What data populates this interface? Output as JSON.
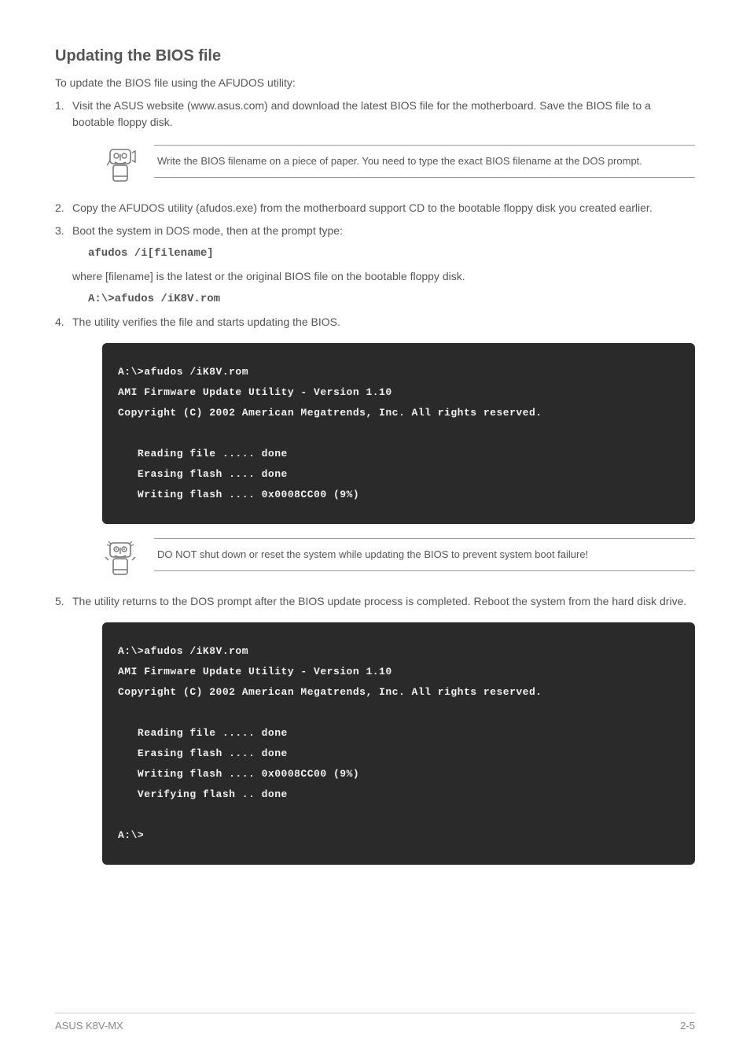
{
  "header": {
    "title": "Updating the BIOS file"
  },
  "intro": "To update the BIOS file using the AFUDOS utility:",
  "steps": {
    "s1_num": "1.",
    "s1_text_a": "Visit the ASUS website (www.asus.com) and download the latest BIOS file for the motherboard. Save the BIOS file to a bootable floppy disk.",
    "s2_num": "2.",
    "s2_text": "Copy the AFUDOS utility (afudos.exe) from the motherboard support CD to the bootable floppy disk you created earlier.",
    "s3_num": "3.",
    "s3_text": "Boot the system in DOS mode, then at the prompt type:",
    "s3_cmd": "afudos /i[filename]",
    "s3_after": "where [filename] is the latest or the original BIOS file on the bootable floppy disk.",
    "s3_example": "A:\\>afudos /iK8V.rom",
    "s4_num": "4.",
    "s4_text": "The utility verifies the file and starts updating the BIOS.",
    "s5_num": "5.",
    "s5_text": "The utility returns to the DOS prompt after the BIOS update process is completed. Reboot the system from the hard disk drive."
  },
  "notes": {
    "note1": "Write the BIOS filename on a piece of paper. You need to type the exact BIOS filename at the DOS prompt.",
    "note2": "DO NOT shut down or reset the system while updating the BIOS to prevent system boot failure!"
  },
  "terminals": {
    "t1": "A:\\>afudos /iK8V.rom\nAMI Firmware Update Utility - Version 1.10\nCopyright (C) 2002 American Megatrends, Inc. All rights reserved.\n\n   Reading file ..... done\n   Erasing flash .... done\n   Writing flash .... 0x0008CC00 (9%)",
    "t2": "A:\\>afudos /iK8V.rom\nAMI Firmware Update Utility - Version 1.10\nCopyright (C) 2002 American Megatrends, Inc. All rights reserved.\n\n   Reading file ..... done\n   Erasing flash .... done\n   Writing flash .... 0x0008CC00 (9%)\n   Verifying flash .. done\n\nA:\\>"
  },
  "footer": {
    "left": "ASUS K8V-MX",
    "right": "2-5"
  }
}
